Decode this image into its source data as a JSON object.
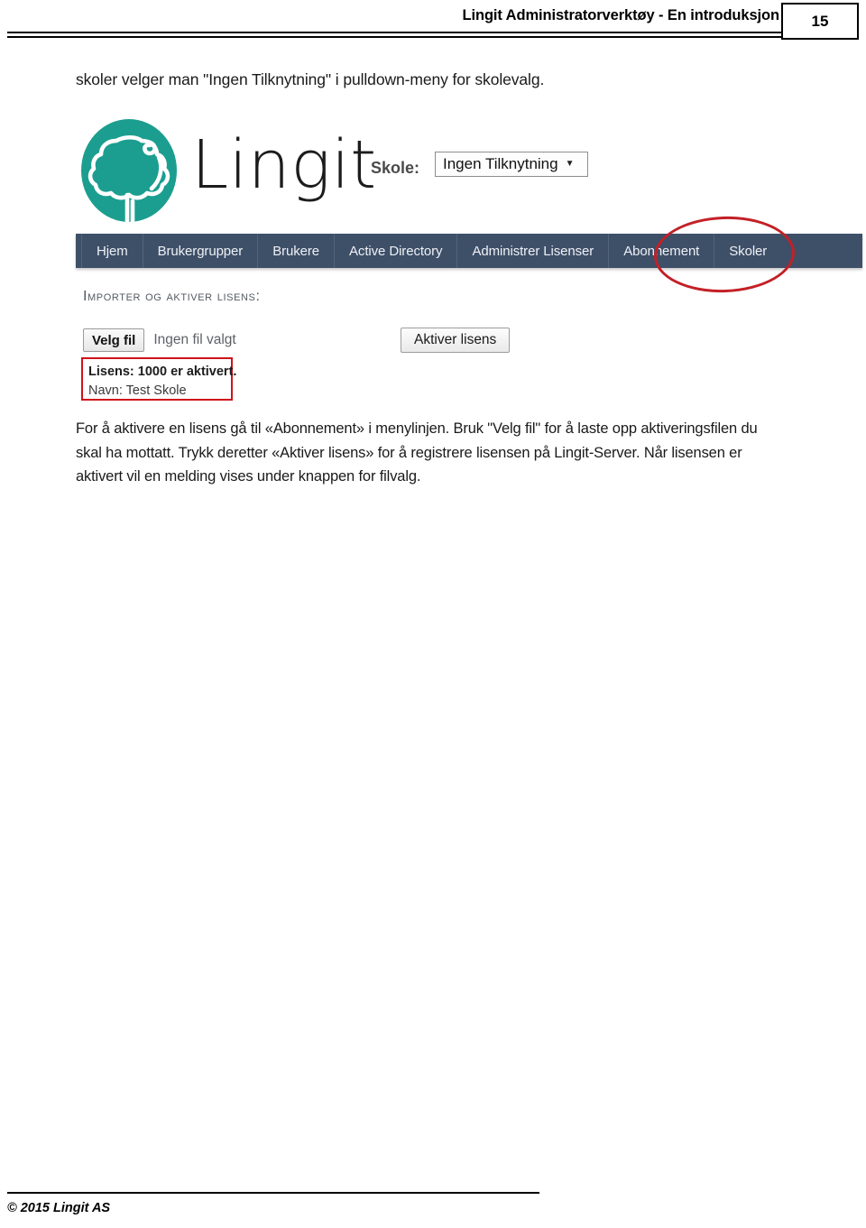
{
  "header": {
    "title": "Lingit Administratorverktøy - En introduksjon",
    "page_number": "15"
  },
  "intro": {
    "text": "skoler velger man \"Ingen Tilknytning\" i pulldown-meny for skolevalg."
  },
  "app": {
    "logo_icon": "lingit-tree-logo-icon",
    "brand_color": "#1b9e8f",
    "wordmark": "Lingit",
    "school_label": "Skole:",
    "school_select_value": "Ingen Tilknytning",
    "school_select_caret": "▼",
    "nav": {
      "items": [
        {
          "label": "Hjem"
        },
        {
          "label": "Brukergrupper"
        },
        {
          "label": "Brukere"
        },
        {
          "label": "Active Directory"
        },
        {
          "label": "Administrer Lisenser"
        },
        {
          "label": "Abonnement"
        },
        {
          "label": "Skoler"
        }
      ],
      "highlighted_item": "Abonnement",
      "highlight_color": "#c32026",
      "bar_color": "#3e4f68"
    },
    "section_title": "Importer og aktiver lisens:",
    "choose_file_button": "Velg fil",
    "file_status_text": "Ingen fil valgt",
    "activate_button": "Aktiver lisens",
    "license_status": {
      "line1": "Lisens: 1000 er aktivert.",
      "line2": "Navn: Test Skole",
      "border_color": "#d0131a"
    }
  },
  "body": {
    "paragraph": "For å aktivere en lisens gå til «Abonnement» i menylinjen. Bruk \"Velg fil\" for å laste opp aktiveringsfilen du skal ha mottatt. Trykk deretter «Aktiver lisens» for å registrere lisensen på Lingit-Server. Når lisensen er aktivert vil en melding vises under knappen for filvalg."
  },
  "footer": {
    "copyright": "© 2015 Lingit AS"
  }
}
